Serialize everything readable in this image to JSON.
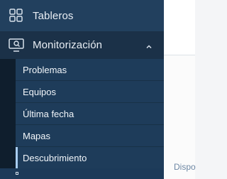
{
  "nav": {
    "tableros_label": "Tableros",
    "monitorizacion_label": "Monitorización",
    "items": [
      {
        "label": "Problemas"
      },
      {
        "label": "Equipos"
      },
      {
        "label": "Última fecha"
      },
      {
        "label": "Mapas"
      },
      {
        "label": "Descubrimiento"
      }
    ],
    "active_item": "Descubrimiento"
  },
  "content": {
    "partial_text": "Dispo"
  },
  "colors": {
    "sidebar_bg": "#17283a",
    "submenu_bg": "#1e3c5a",
    "active_indicator": "#a9cdf0",
    "content_text": "#6d87a4"
  },
  "icons": {
    "tableros": "dashboard-grid-icon",
    "monitorizacion": "monitor-search-icon",
    "chevron": "chevron-up-icon"
  }
}
